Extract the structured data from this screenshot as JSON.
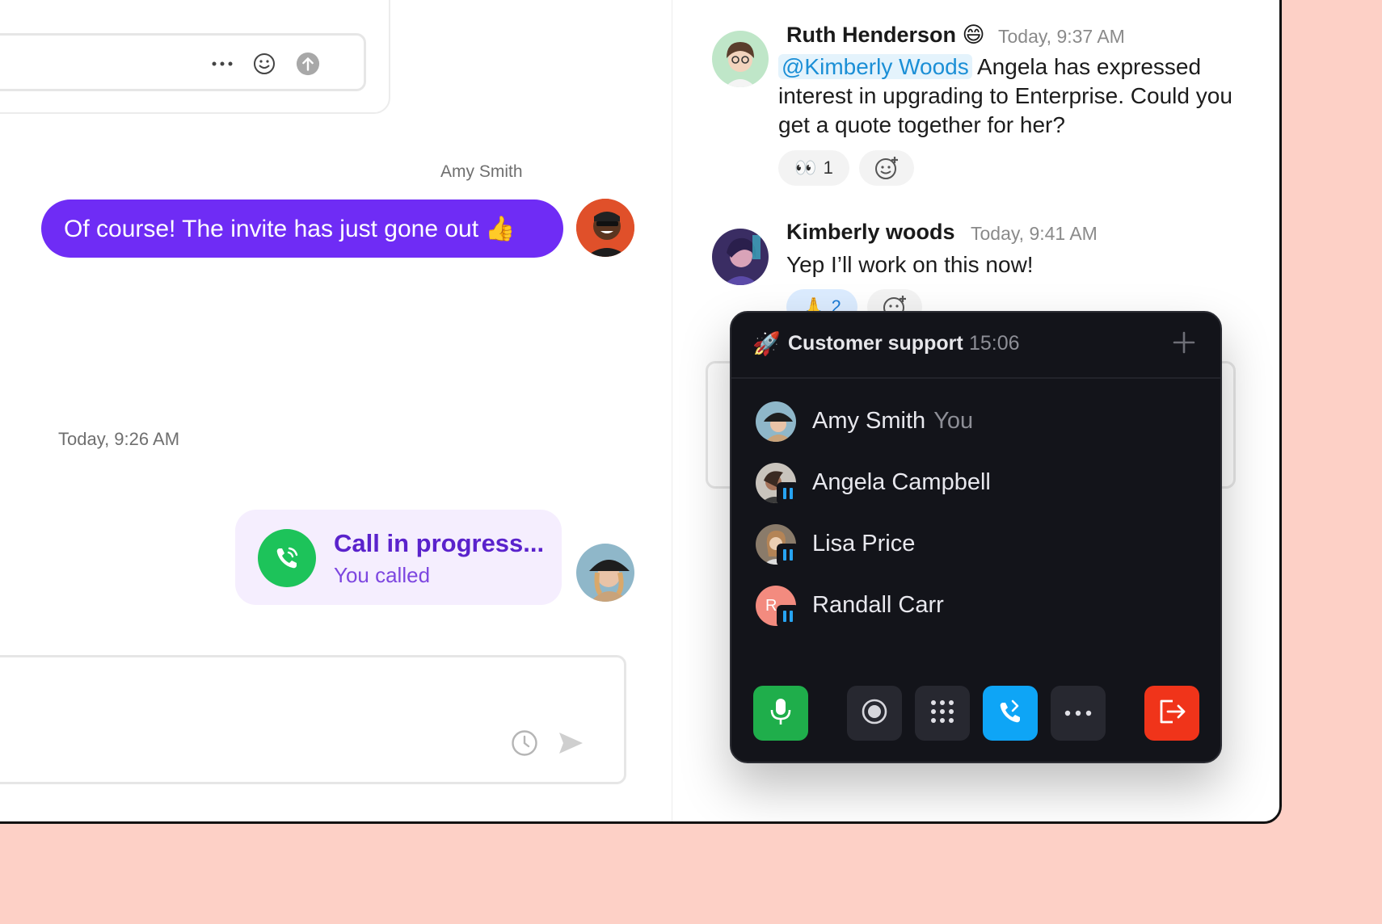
{
  "left_pane": {
    "outgoing_message": {
      "sender": "Amy Smith",
      "text": "Of course! The invite has just gone out 👍"
    },
    "timestamp": "Today, 9:26 AM",
    "call_card": {
      "title": "Call in progress...",
      "subtitle": "You called"
    }
  },
  "right_pane": {
    "messages": [
      {
        "name": "Ruth Henderson",
        "emoji": "😄",
        "time": "Today, 9:37 AM",
        "mention": "@Kimberly Woods",
        "text_after_mention": " Angela has expressed interest in upgrading to Enterprise. Could you get a quote together for her?",
        "reactions": [
          {
            "emoji": "👀",
            "count": "1"
          }
        ]
      },
      {
        "name": "Kimberly woods",
        "time": "Today, 9:41 AM",
        "text": "Yep I’ll work on this now!",
        "reactions": [
          {
            "emoji": "🙏",
            "count": "2"
          }
        ]
      }
    ]
  },
  "call_panel": {
    "channel_emoji": "🚀",
    "channel_name": "Customer support",
    "timer": "15:06",
    "participants": [
      {
        "name": "Amy Smith",
        "tag": "You",
        "paused": false
      },
      {
        "name": "Angela Campbell",
        "paused": true
      },
      {
        "name": "Lisa Price",
        "paused": true
      },
      {
        "name": "Randall Carr",
        "initial": "R",
        "paused": true
      }
    ],
    "controls": [
      "mic-icon",
      "record-icon",
      "dialpad-icon",
      "transfer-call-icon",
      "more-icon",
      "leave-call-icon"
    ]
  },
  "colors": {
    "bubble": "#6f2cf5",
    "call_green": "#1dc35a",
    "panel_bg": "#13141a",
    "mic_green": "#1fae4b",
    "transfer_blue": "#0ea5f6",
    "leave_red": "#f0341a",
    "backdrop": "#fdd0c6"
  }
}
